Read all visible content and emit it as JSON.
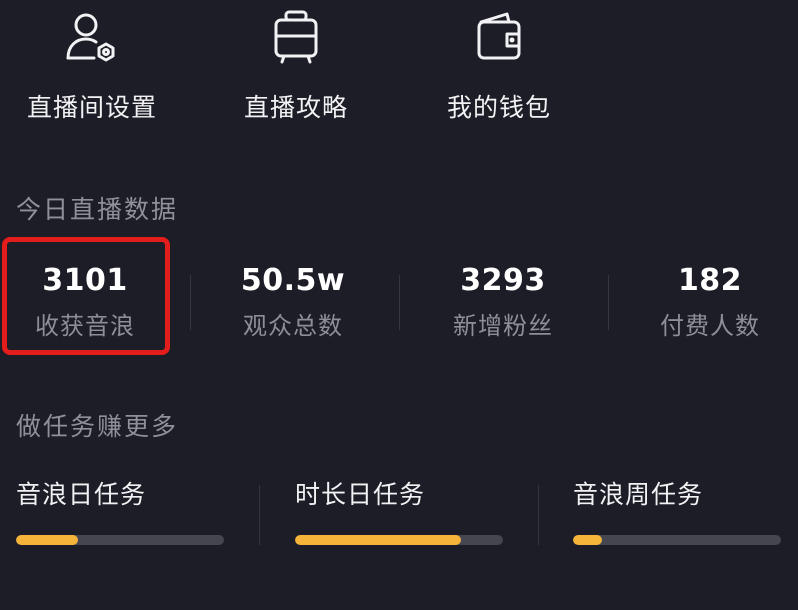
{
  "quick_actions": [
    {
      "label": "直播间设置",
      "icon": "user-gear-icon"
    },
    {
      "label": "直播攻略",
      "icon": "briefcase-icon"
    },
    {
      "label": "我的钱包",
      "icon": "wallet-icon"
    }
  ],
  "today": {
    "title": "今日直播数据",
    "stats": [
      {
        "value": "3101",
        "caption": "收获音浪"
      },
      {
        "value": "50.5w",
        "caption": "观众总数"
      },
      {
        "value": "3293",
        "caption": "新增粉丝"
      },
      {
        "value": "182",
        "caption": "付费人数"
      }
    ]
  },
  "tasks": {
    "title": "做任务赚更多",
    "items": [
      {
        "name": "音浪日任务",
        "progress": 0.3
      },
      {
        "name": "时长日任务",
        "progress": 0.8
      },
      {
        "name": "音浪周任务",
        "progress": 0.14
      }
    ]
  },
  "colors": {
    "background": "#1c1d26",
    "progress": "#f5b43a",
    "highlight": "#e31c1c"
  }
}
